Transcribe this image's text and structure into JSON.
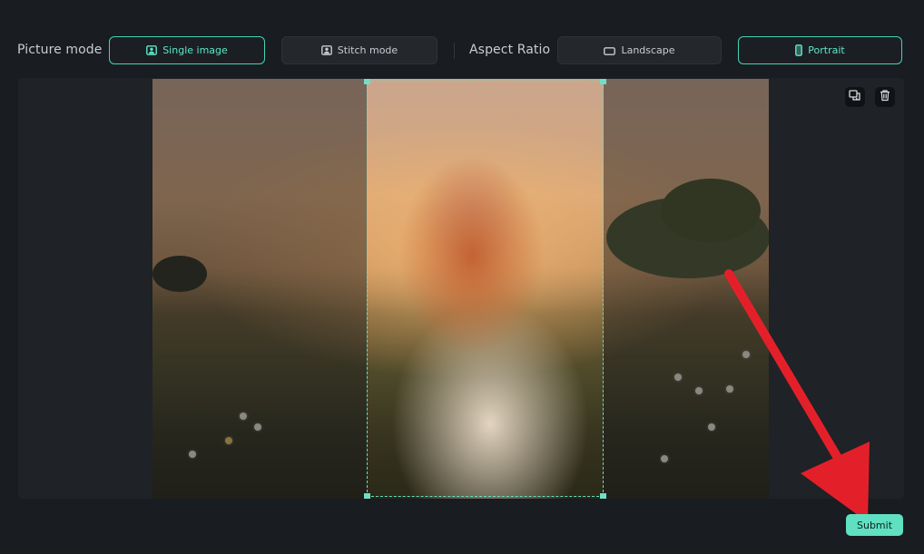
{
  "toolbar": {
    "picture_mode_label": "Picture mode",
    "single_image_label": "Single image",
    "stitch_mode_label": "Stitch mode",
    "aspect_ratio_label": "Aspect Ratio",
    "landscape_label": "Landscape",
    "portrait_label": "Portrait",
    "selected_picture_mode": "Single image",
    "selected_aspect_ratio": "Portrait"
  },
  "canvas": {
    "image_subject": "woman-in-wildflower-field-at-sunset",
    "crop_mode": "Portrait"
  },
  "tools": [
    "replace-image-icon",
    "trash-icon"
  ],
  "actions": {
    "submit_label": "Submit"
  },
  "colors": {
    "accent": "#5ee0c1",
    "background": "#191c20",
    "arrow": "#e3202a"
  }
}
